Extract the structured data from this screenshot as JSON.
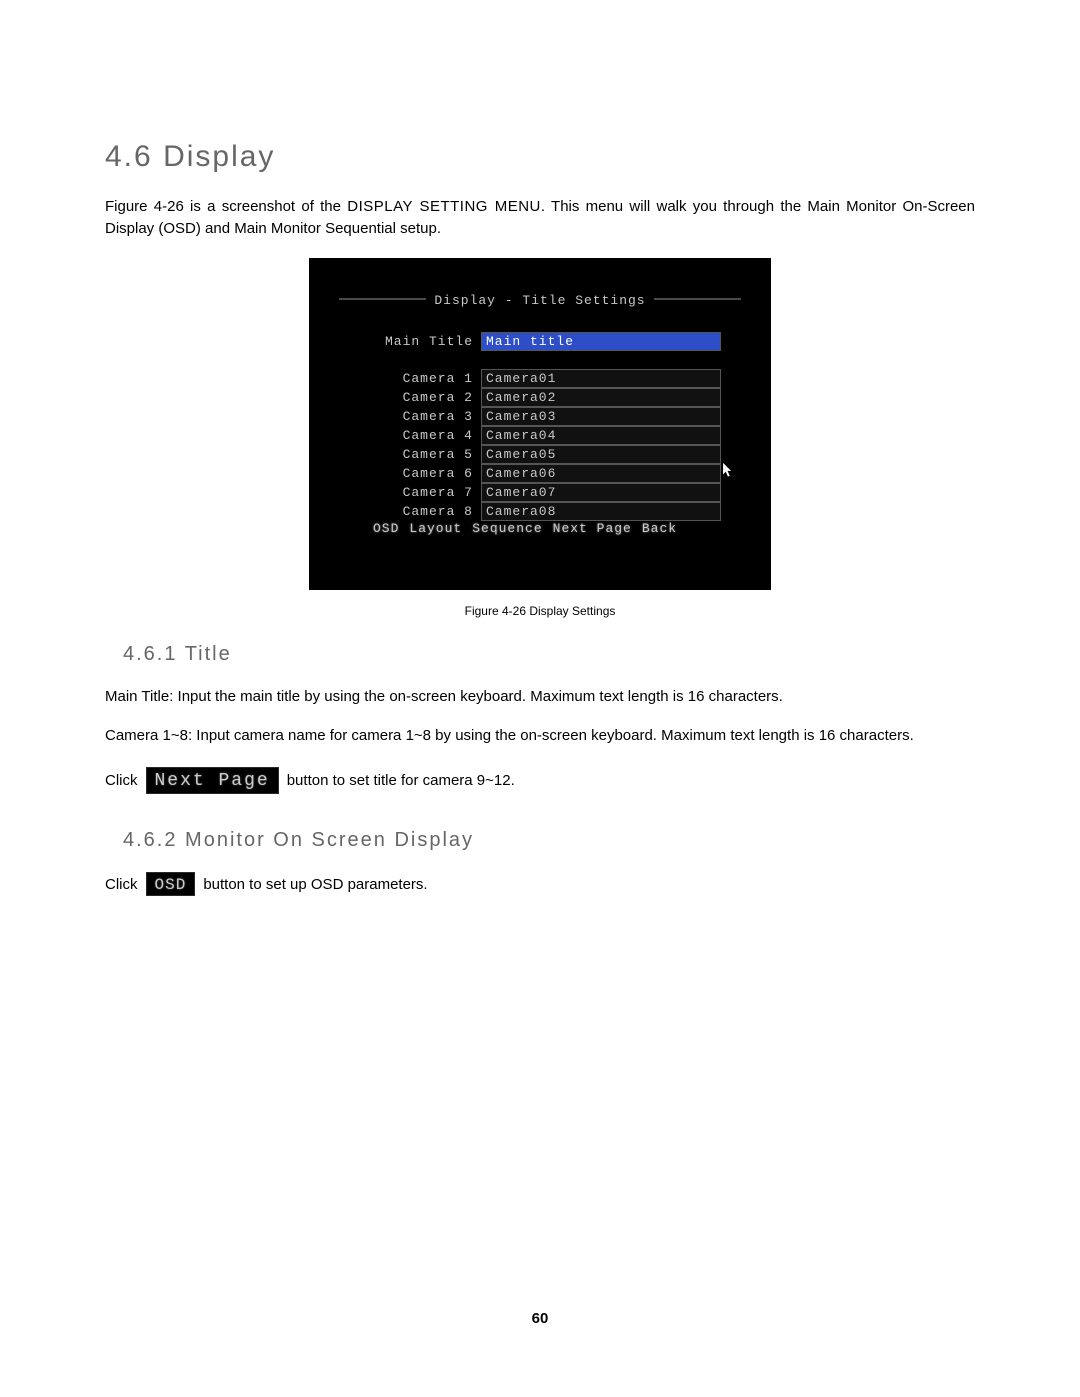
{
  "page_number": "60",
  "sec46": {
    "num": "4.6",
    "title": "Display"
  },
  "intro": {
    "fig_ref": "Figure 4-26",
    "caps": "DISPLAY SETTING MENU",
    "before": " is a screenshot of the ",
    "after": ". This menu will walk you through the Main Monitor On-Screen Display (OSD) and Main Monitor Sequential setup."
  },
  "shot": {
    "header": "Display - Title Settings",
    "main_label": "Main Title",
    "main_value": "Main title",
    "cameras": [
      {
        "label": "Camera 1",
        "value": "Camera01"
      },
      {
        "label": "Camera 2",
        "value": "Camera02"
      },
      {
        "label": "Camera 3",
        "value": "Camera03"
      },
      {
        "label": "Camera 4",
        "value": "Camera04"
      },
      {
        "label": "Camera 5",
        "value": "Camera05"
      },
      {
        "label": "Camera 6",
        "value": "Camera06"
      },
      {
        "label": "Camera 7",
        "value": "Camera07"
      },
      {
        "label": "Camera 8",
        "value": "Camera08"
      }
    ],
    "menu": [
      "OSD",
      "Layout",
      "Sequence",
      "Next Page",
      "Back"
    ],
    "caption": "Figure 4-26 Display Settings"
  },
  "sec461": {
    "num": "4.6.1",
    "title": "Title",
    "p1a": "Main Title:",
    "p1b": " Input the main title by using the on-screen keyboard. Maximum text length is 16 characters.",
    "p2a": "Camera 1~8:",
    "p2b": " Input camera name for camera 1~8 by using the on-screen keyboard. Maximum text length is 16 characters.",
    "click_pre": "Click",
    "btn": "Next Page",
    "click_post": " button to set title for camera 9~12."
  },
  "sec462": {
    "num": "4.6.2",
    "title": "Monitor On Screen Display",
    "click_pre": "Click",
    "btn": "OSD",
    "click_post": " button to set up OSD parameters."
  }
}
